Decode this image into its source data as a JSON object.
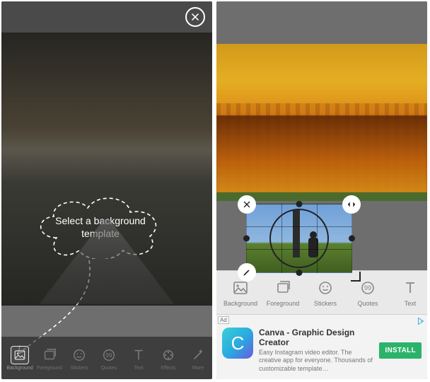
{
  "left": {
    "hint": "Select a background template",
    "tools": [
      {
        "icon": "image",
        "label": "Background",
        "active": true
      },
      {
        "icon": "image-stack",
        "label": "Foreground"
      },
      {
        "icon": "face",
        "label": "Stickers"
      },
      {
        "icon": "quotes",
        "label": "Quotes"
      },
      {
        "icon": "text",
        "label": "Text"
      },
      {
        "icon": "film",
        "label": "Effects"
      },
      {
        "icon": "wand",
        "label": "More"
      }
    ]
  },
  "right": {
    "tools": [
      {
        "icon": "image",
        "label": "Background"
      },
      {
        "icon": "image-stack",
        "label": "Foreground"
      },
      {
        "icon": "face",
        "label": "Stickers"
      },
      {
        "icon": "quotes",
        "label": "Quotes"
      },
      {
        "icon": "text",
        "label": "Text"
      }
    ],
    "ad": {
      "badge": "Ad",
      "logo_letter": "C",
      "title": "Canva - Graphic Design Creator",
      "body": "Easy Instagram video editor. The creative app for everyone. Thousands of customizable template…",
      "cta": "INSTALL"
    }
  }
}
